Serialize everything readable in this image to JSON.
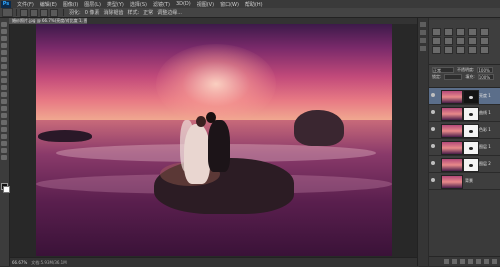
{
  "app": {
    "logo": "Ps"
  },
  "menubar": {
    "items": [
      "文件(F)",
      "编辑(E)",
      "图像(I)",
      "图层(L)",
      "类型(Y)",
      "选择(S)",
      "滤镜(T)",
      "3D(D)",
      "视图(V)",
      "窗口(W)",
      "帮助(H)"
    ]
  },
  "options": {
    "label_feather": "羽化:",
    "feather_value": "0 像素",
    "label_antialias": "消除锯齿",
    "label_style": "样式:",
    "style_value": "正常",
    "label_edge": "调整边缘..."
  },
  "document": {
    "tab_title": "婚纱照片.jpg @ 66.7%(亮度/对比度 1, 图层蒙版/8) *"
  },
  "status": {
    "zoom": "66.67%",
    "doc_info": "文档:5.93M/36.1M"
  },
  "layers": {
    "header": {
      "mode": "正常",
      "opacity_label": "不透明度:",
      "opacity_value": "100%",
      "fill_label": "填充:",
      "fill_value": "100%",
      "lock_label": "锁定:"
    },
    "items": [
      {
        "name": "亮度 1",
        "mask": "dark",
        "selected": true
      },
      {
        "name": "曲线 1",
        "mask": "light",
        "selected": false
      },
      {
        "name": "色彩 1",
        "mask": "light",
        "selected": false
      },
      {
        "name": "图层 1",
        "mask": "light",
        "selected": false
      },
      {
        "name": "图层 2",
        "mask": "light",
        "selected": false
      },
      {
        "name": "背景",
        "mask": "none",
        "selected": false
      }
    ]
  },
  "colors": {
    "accent": "#5b6e8a",
    "foreground": "#111111",
    "background": "#ffffff"
  }
}
